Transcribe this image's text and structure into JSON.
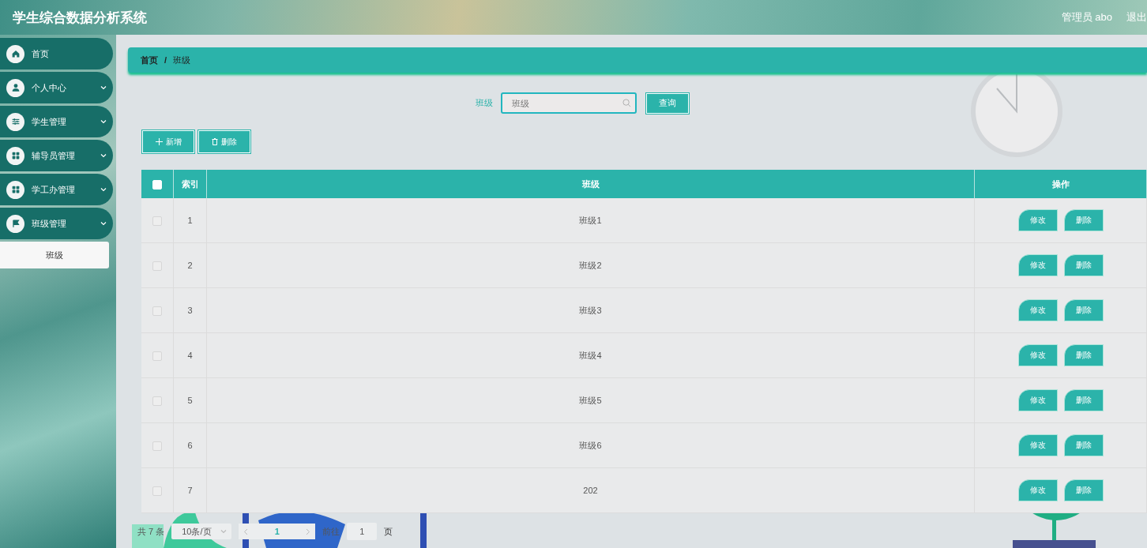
{
  "header": {
    "title": "学生综合数据分析系统",
    "user": "管理员 abo",
    "logout": "退出"
  },
  "sidebar": {
    "items": [
      {
        "label": "首页",
        "kind": "link"
      },
      {
        "label": "个人中心",
        "kind": "submenu"
      },
      {
        "label": "学生管理",
        "kind": "submenu"
      },
      {
        "label": "辅导员管理",
        "kind": "submenu"
      },
      {
        "label": "学工办管理",
        "kind": "submenu"
      },
      {
        "label": "班级管理",
        "kind": "submenu",
        "children": [
          {
            "label": "班级",
            "selected": true
          }
        ]
      }
    ]
  },
  "breadcrumb": [
    "首页",
    "/",
    "班级"
  ],
  "search": {
    "label": "班级",
    "placeholder": "班级",
    "button": "查询"
  },
  "toolbar": [
    "新增",
    "删除"
  ],
  "table": {
    "select_all": false,
    "columns": [
      "索引",
      "班级",
      "操作"
    ],
    "rows": [
      {
        "checked": false,
        "index": "1",
        "name": "班级1",
        "actions": [
          "修改",
          "删除"
        ]
      },
      {
        "checked": false,
        "index": "2",
        "name": "班级2",
        "actions": [
          "修改",
          "删除"
        ]
      },
      {
        "checked": false,
        "index": "3",
        "name": "班级3",
        "actions": [
          "修改",
          "删除"
        ]
      },
      {
        "checked": false,
        "index": "4",
        "name": "班级4",
        "actions": [
          "修改",
          "删除"
        ]
      },
      {
        "checked": false,
        "index": "5",
        "name": "班级5",
        "actions": [
          "修改",
          "删除"
        ]
      },
      {
        "checked": false,
        "index": "6",
        "name": "班级6",
        "actions": [
          "修改",
          "删除"
        ]
      },
      {
        "checked": false,
        "index": "7",
        "name": "202",
        "actions": [
          "修改",
          "删除"
        ]
      }
    ]
  },
  "pagination": {
    "total": "共 7 条",
    "page_size": "10条/页",
    "current": "1",
    "goto_label": "前往",
    "goto_value": "1",
    "goto_suffix": "页"
  }
}
